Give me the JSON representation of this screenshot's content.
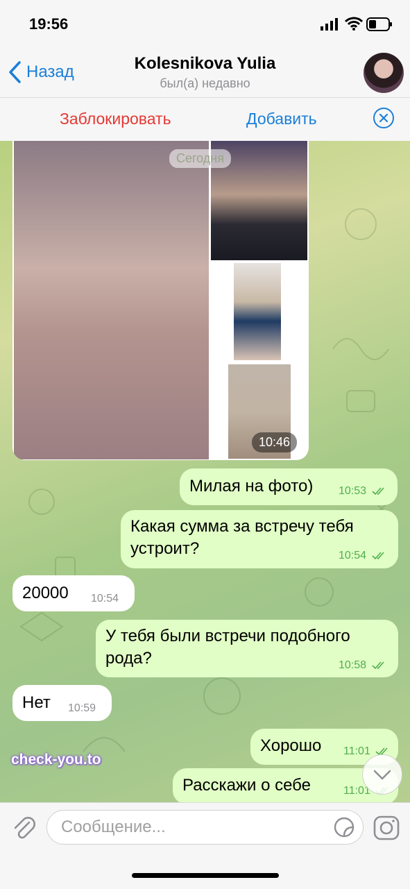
{
  "status_bar": {
    "time": "19:56"
  },
  "header": {
    "back_label": "Назад",
    "title": "Kolesnikova Yulia",
    "subtitle": "был(а) недавно"
  },
  "action_bar": {
    "block_label": "Заблокировать",
    "add_label": "Добавить"
  },
  "chat": {
    "date_label": "Сегодня",
    "album": {
      "time": "10:46",
      "photo_count": 4
    },
    "messages": [
      {
        "dir": "out",
        "text": "Милая на фото)",
        "time": "10:53",
        "read": true
      },
      {
        "dir": "out",
        "text": "Какая сумма за встречу тебя устроит?",
        "time": "10:54",
        "read": true
      },
      {
        "dir": "in",
        "text": "20000",
        "time": "10:54"
      },
      {
        "dir": "out",
        "text": "У тебя были встречи подобного рода?",
        "time": "10:58",
        "read": true
      },
      {
        "dir": "in",
        "text": "Нет",
        "time": "10:59"
      },
      {
        "dir": "out",
        "text": "Хорошо",
        "time": "11:01",
        "read": true
      },
      {
        "dir": "out",
        "text": "Расскажи о себе",
        "time": "11:01",
        "read": true
      }
    ]
  },
  "input": {
    "placeholder": "Сообщение..."
  },
  "watermark": "check-you.to",
  "icons": [
    "back-chevron-icon",
    "close-circle-icon",
    "attach-paperclip-icon",
    "sticker-icon",
    "camera-icon",
    "scroll-down-icon",
    "double-check-icon"
  ],
  "colors": {
    "accent": "#1a7fd8",
    "danger": "#e53935",
    "outgoing": "#e1fec6",
    "incoming": "#ffffff",
    "check": "#4fae4e"
  }
}
